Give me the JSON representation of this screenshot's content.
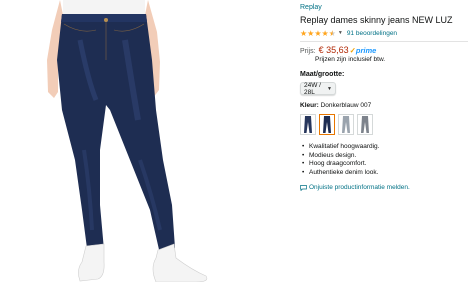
{
  "product": {
    "brand_link": "Replay",
    "title": "Replay dames skinny jeans NEW LUZ",
    "rating": {
      "value": 4.5,
      "stars_full": 4,
      "stars_half": 1,
      "reviews_text": "91 beoordelingen"
    },
    "price": {
      "label": "Prijs:",
      "value": "€ 35,63",
      "prime_label": "prime",
      "vat_note": "Prijzen zijn inclusief btw."
    },
    "size": {
      "label": "Maat/grootte:",
      "selected": "24W / 28L"
    },
    "color": {
      "label": "Kleur:",
      "value": "Donkerblauw 007"
    },
    "swatch_icons": [
      "jeans-dark-blue",
      "jeans-dark-blue-selected",
      "jeans-light-grey",
      "jeans-grey"
    ],
    "bullets": [
      "Kwalitatief hoogwaardig.",
      "Modieus design.",
      "Hoog draagcomfort.",
      "Authentieke denim look."
    ],
    "report_link": "Onjuiste productinformatie melden."
  },
  "colors": {
    "link": "#007185",
    "price": "#b12704",
    "star": "#ffa41c",
    "prime": "#1a98ff",
    "denim": "#1e2d52",
    "selected_border": "#e77600"
  }
}
